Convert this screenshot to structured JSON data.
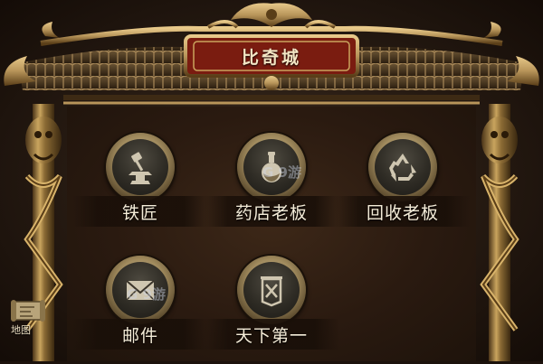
{
  "title": "比奇城",
  "npcs": [
    {
      "label": "铁匠",
      "icon": "anvil-hammer-icon"
    },
    {
      "label": "药店老板",
      "icon": "potion-flask-icon"
    },
    {
      "label": "回收老板",
      "icon": "recycle-icon"
    },
    {
      "label": "邮件",
      "icon": "envelope-icon"
    },
    {
      "label": "天下第一",
      "icon": "banner-flag-icon"
    }
  ],
  "map_button": {
    "label": "地图",
    "icon": "map-scroll-icon"
  },
  "watermark": {
    "text": "G 9游"
  },
  "colors": {
    "frame_gold": "#b8955a",
    "roof_red": "#7a1c10",
    "panel_bg": "#2a1a10",
    "label_text": "#f4ecd8"
  }
}
